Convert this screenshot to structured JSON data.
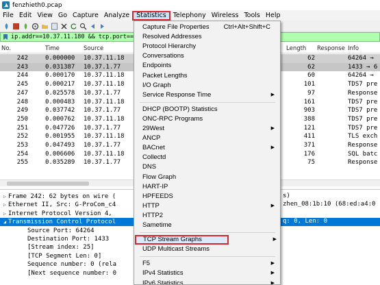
{
  "window": {
    "title": "fenzhieth0.pcap",
    "icon": "wireshark-fin-icon"
  },
  "menubar": [
    "File",
    "Edit",
    "View",
    "Go",
    "Capture",
    "Analyze",
    "Statistics",
    "Telephony",
    "Wireless",
    "Tools",
    "Help"
  ],
  "filter": {
    "text": "ip.addr==10.37.11.180 && tcp.port==64..."
  },
  "columns": {
    "no": "No.",
    "time": "Time",
    "source": "Source",
    "length": "Length",
    "response": "Response",
    "info": "Info"
  },
  "packets": [
    {
      "no": "242",
      "time": "0.000000",
      "source": "10.37.11.18",
      "length": "62",
      "response": "",
      "info": "64264 →"
    },
    {
      "no": "243",
      "time": "0.031387",
      "source": "10.37.1.77",
      "length": "62",
      "response": "",
      "info": "1433 → 6"
    },
    {
      "no": "244",
      "time": "0.000170",
      "source": "10.37.11.18",
      "length": "60",
      "response": "",
      "info": "64264 →"
    },
    {
      "no": "245",
      "time": "0.000217",
      "source": "10.37.11.18",
      "length": "101",
      "response": "",
      "info": "TDS7 pre"
    },
    {
      "no": "247",
      "time": "0.025578",
      "source": "10.37.1.77",
      "length": "97",
      "response": "",
      "info": "Response"
    },
    {
      "no": "248",
      "time": "0.000483",
      "source": "10.37.11.18",
      "length": "161",
      "response": "",
      "info": "TDS7 pre"
    },
    {
      "no": "249",
      "time": "0.037742",
      "source": "10.37.1.77",
      "length": "903",
      "response": "",
      "info": "TDS7 pre"
    },
    {
      "no": "250",
      "time": "0.000762",
      "source": "10.37.11.18",
      "length": "388",
      "response": "",
      "info": "TDS7 pre"
    },
    {
      "no": "251",
      "time": "0.047726",
      "source": "10.37.1.77",
      "length": "121",
      "response": "",
      "info": "TDS7 pre"
    },
    {
      "no": "252",
      "time": "0.001955",
      "source": "10.37.11.18",
      "length": "411",
      "response": "",
      "info": "TLS exch"
    },
    {
      "no": "253",
      "time": "0.047493",
      "source": "10.37.1.77",
      "length": "371",
      "response": "",
      "info": "Response"
    },
    {
      "no": "254",
      "time": "0.006606",
      "source": "10.37.11.18",
      "length": "176",
      "response": "",
      "info": "SQL batc"
    },
    {
      "no": "255",
      "time": "0.035289",
      "source": "10.37.1.77",
      "length": "75",
      "response": "",
      "info": "Response"
    }
  ],
  "details": [
    {
      "arrow": "▷",
      "text": "Frame 242: 62 bytes on wire ("
    },
    {
      "arrow": "▷",
      "text": "Ethernet II, Src: G-ProCom_c4"
    },
    {
      "arrow": "▷",
      "text": "Internet Protocol Version 4,"
    },
    {
      "arrow": "◢",
      "text": "Transmission Control Protocol"
    },
    {
      "arrow": "",
      "text": "Source Port: 64264"
    },
    {
      "arrow": "",
      "text": "Destination Port: 1433"
    },
    {
      "arrow": "",
      "text": "[Stream index: 25]"
    },
    {
      "arrow": "",
      "text": "[TCP Segment Len: 0]"
    },
    {
      "arrow": "",
      "text": "Sequence number: 0    (rela"
    },
    {
      "arrow": "",
      "text": "[Next sequence number: 0"
    }
  ],
  "details_right": {
    "line1": "s)",
    "line2": "zhen_08:1b:10 (68:ed:a4:0",
    "line4": "q: 0, Len: 0"
  },
  "statistics_menu": [
    {
      "label": "Capture File Properties",
      "shortcut": "Ctrl+Alt+Shift+C"
    },
    {
      "label": "Resolved Addresses"
    },
    {
      "label": "Protocol Hierarchy"
    },
    {
      "label": "Conversations"
    },
    {
      "label": "Endpoints"
    },
    {
      "label": "Packet Lengths"
    },
    {
      "label": "I/O Graph"
    },
    {
      "label": "Service Response Time",
      "submenu": true
    },
    {
      "label": "DHCP (BOOTP) Statistics"
    },
    {
      "label": "ONC-RPC Programs"
    },
    {
      "label": "29West",
      "submenu": true
    },
    {
      "label": "ANCP"
    },
    {
      "label": "BACnet",
      "submenu": true
    },
    {
      "label": "Collectd"
    },
    {
      "label": "DNS"
    },
    {
      "label": "Flow Graph"
    },
    {
      "label": "HART-IP"
    },
    {
      "label": "HPFEEDS"
    },
    {
      "label": "HTTP",
      "submenu": true
    },
    {
      "label": "HTTP2"
    },
    {
      "label": "Sametime"
    },
    {
      "label": "TCP Stream Graphs",
      "submenu": true,
      "highlighted": true
    },
    {
      "label": "UDP Multicast Streams"
    },
    {
      "label": "F5",
      "submenu": true
    },
    {
      "label": "IPv4 Statistics",
      "submenu": true
    },
    {
      "label": "IPv6 Statistics",
      "submenu": true
    }
  ],
  "colors": {
    "filter_bg": "#afffaf",
    "selection": "#0078d7",
    "highlight_border": "#d9252b"
  }
}
